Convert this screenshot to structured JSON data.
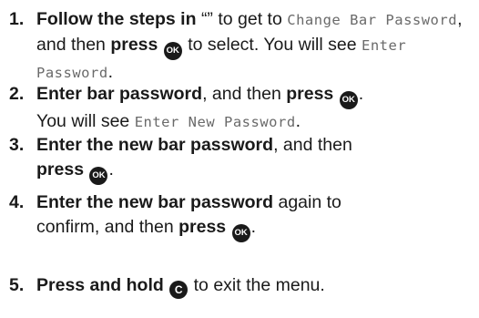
{
  "steps": [
    {
      "number": "1.",
      "bold_lead": "Follow the steps in",
      "quote": "“”",
      "text_a": " to get to ",
      "screen_a": "Change Bar Password",
      "text_b": ", and then ",
      "press": "press",
      "key": "OK",
      "text_c": " to select. You will see ",
      "screen_b": "Enter Password",
      "text_d": "."
    },
    {
      "number": "2.",
      "bold_lead": "Enter bar password",
      "text_a": ", and then ",
      "press": "press",
      "key": "OK",
      "text_b": ".",
      "text_c": "You will see ",
      "screen_a": "Enter New Password",
      "text_d": "."
    },
    {
      "number": "3.",
      "bold_lead": "Enter the new bar password",
      "text_a": ", and then",
      "press": "press",
      "key": "OK",
      "text_b": "."
    },
    {
      "number": "4.",
      "bold_lead": "Enter the new bar password",
      "text_a": " again to",
      "text_b": "confirm, and then ",
      "press": "press",
      "key": "OK",
      "text_c": "."
    },
    {
      "number": "5.",
      "bold_lead": "Press and hold",
      "key": "C",
      "text_a": " to exit the menu."
    }
  ]
}
